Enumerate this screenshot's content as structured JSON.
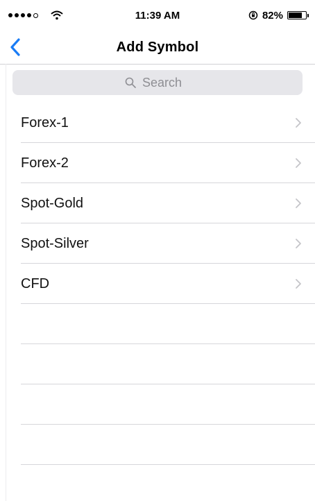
{
  "status_bar": {
    "time": "11:39 AM",
    "battery_percent": "82%",
    "battery_level": 0.82,
    "signal_bars": 4,
    "signal_max": 5
  },
  "nav": {
    "title": "Add Symbol",
    "back_icon": "chevron-left-icon",
    "accent_color": "#1a7cf5"
  },
  "search": {
    "placeholder": "Search",
    "value": ""
  },
  "list": {
    "items": [
      {
        "label": "Forex-1"
      },
      {
        "label": "Forex-2"
      },
      {
        "label": "Spot-Gold"
      },
      {
        "label": "Spot-Silver"
      },
      {
        "label": "CFD"
      }
    ],
    "row_icon": "chevron-right-icon"
  }
}
